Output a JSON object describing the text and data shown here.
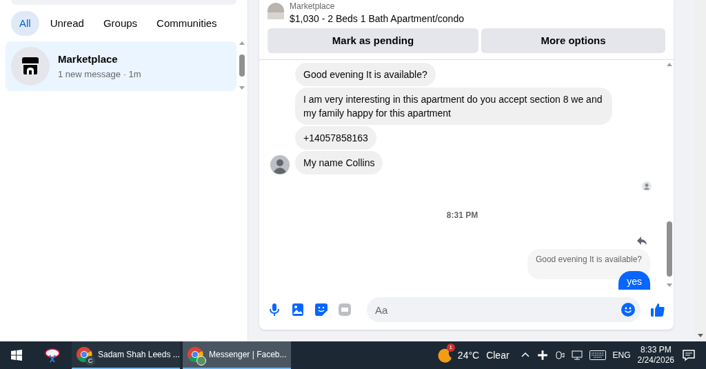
{
  "filters": [
    {
      "label": "All",
      "selected": true
    },
    {
      "label": "Unread",
      "selected": false
    },
    {
      "label": "Groups",
      "selected": false
    },
    {
      "label": "Communities",
      "selected": false
    }
  ],
  "conversations": [
    {
      "name": "Marketplace",
      "preview": "1 new message · 1m",
      "selected": true
    }
  ],
  "listing": {
    "source": "Marketplace",
    "title": "$1,030 - 2 Beds 1 Bath Apartment/condo",
    "actions": [
      "Mark as pending",
      "More options"
    ]
  },
  "messages": [
    {
      "kind": "incoming",
      "text": "Good evening It is available?"
    },
    {
      "kind": "incoming",
      "text": "I am very interesting in this apartment do you accept section 8 we and my family happy for this apartment"
    },
    {
      "kind": "incoming",
      "text": "+14057858163"
    },
    {
      "kind": "incoming",
      "text": "My name Collins",
      "avatar": true
    },
    {
      "kind": "seen"
    },
    {
      "kind": "timestamp",
      "text": "8:31 PM"
    },
    {
      "kind": "reply_quote",
      "text": "Good evening It is available?"
    },
    {
      "kind": "outgoing",
      "text": "yes"
    }
  ],
  "composer": {
    "placeholder": "Aa"
  },
  "taskbar": {
    "apps": [
      {
        "label": "Sadam Shah Leeds ...",
        "badge": "C",
        "selected": false
      },
      {
        "label": "Messenger | Faceb...",
        "selected": true
      }
    ],
    "weather_badge": "1",
    "temperature": "24°C",
    "condition": "Clear",
    "language": "ENG",
    "time": "8:33 PM",
    "date": "2/24/2026"
  }
}
